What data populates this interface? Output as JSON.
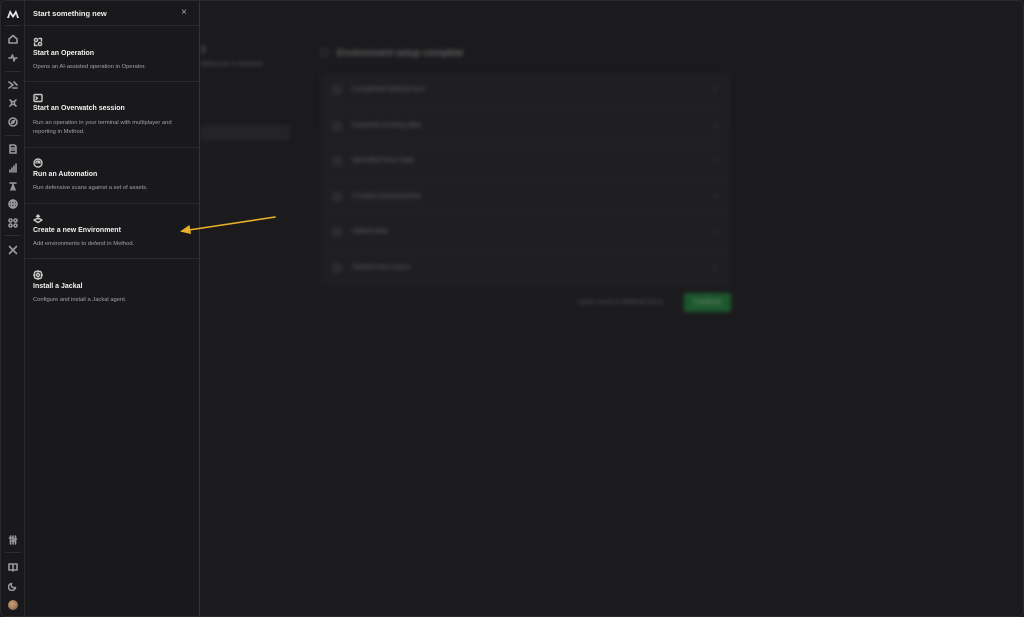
{
  "panel": {
    "title": "Start something new",
    "close_glyph": "×",
    "options": [
      {
        "title": "Start an Operation",
        "description": "Opens an AI-assisted operation in Operator.",
        "icon": "operator-icon"
      },
      {
        "title": "Start an Overwatch session",
        "description": "Run an operation in your terminal with multiplayer and reporting in Method.",
        "icon": "terminal-icon"
      },
      {
        "title": "Run an Automation",
        "description": "Run defensive scans against a set of assets.",
        "icon": "automation-icon"
      },
      {
        "title": "Create a new Environment",
        "description": "Add environments to defend in Method.",
        "icon": "environment-icon"
      },
      {
        "title": "Install a Jackal",
        "description": "Configure and install a Jackal agent.",
        "icon": "jackal-icon"
      }
    ]
  },
  "background": {
    "setup_title": "Environment setup complete",
    "sub": "Welcome to Method",
    "steps": [
      "Completed Method tour",
      "Explored existing data",
      "Specified New Data",
      "Created environments",
      "Added data",
      "Started new scans"
    ],
    "docs_link": "Learn more in Method Docs",
    "continue_label": "Continue"
  },
  "colors": {
    "accent_arrow": "#e8b02a",
    "continue_green": "#1f8a3a",
    "panel_bg": "#19191b"
  },
  "rail_icons": [
    "method-logo-icon",
    "home-icon",
    "activity-icon",
    "operator-icon",
    "broadcast-icon",
    "compass-icon",
    "document-icon",
    "chart-icon",
    "tower-icon",
    "globe-icon",
    "integrations-icon",
    "tools-icon",
    "sliders-icon",
    "book-icon",
    "moon-icon",
    "avatar"
  ]
}
